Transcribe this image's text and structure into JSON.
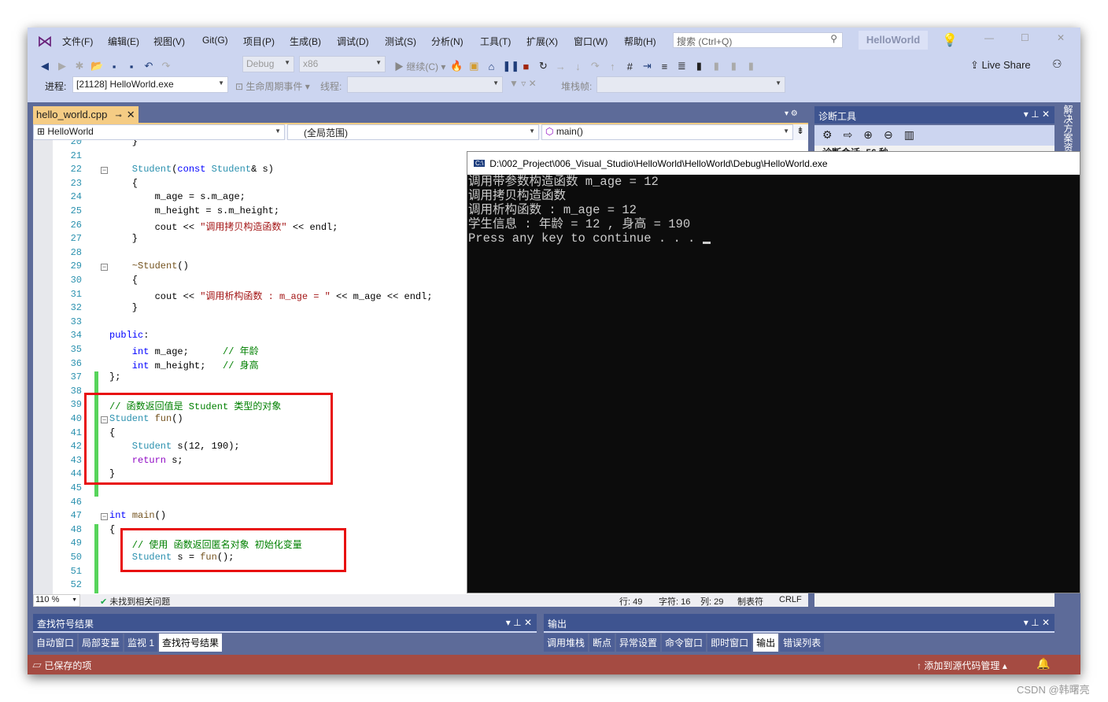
{
  "menu": [
    "文件(F)",
    "编辑(E)",
    "视图(V)",
    "Git(G)",
    "项目(P)",
    "生成(B)",
    "调试(D)",
    "测试(S)",
    "分析(N)",
    "工具(T)",
    "扩展(X)",
    "窗口(W)",
    "帮助(H)"
  ],
  "search": {
    "placeholder": "搜索 (Ctrl+Q)"
  },
  "solution_name": "HelloWorld",
  "toolbar": {
    "config": "Debug",
    "platform": "x86",
    "continue": "继续(C)",
    "live_share": "Live Share"
  },
  "debug_bar": {
    "process_label": "进程:",
    "process_value": "[21128] HelloWorld.exe",
    "lifecycle": "生命周期事件",
    "thread_label": "线程:",
    "stackframe_label": "堆栈帧:"
  },
  "tab": {
    "label": "hello_world.cpp"
  },
  "nav": {
    "project": "HelloWorld",
    "scope": "(全局范围)",
    "member": "main()"
  },
  "code": [
    {
      "n": "20",
      "t": [
        [
          "op",
          "    }"
        ]
      ]
    },
    {
      "n": "21",
      "t": []
    },
    {
      "n": "22",
      "t": [
        [
          "ty",
          "    Student"
        ],
        [
          "op",
          "("
        ],
        [
          "kw",
          "const "
        ],
        [
          "ty",
          "Student"
        ],
        [
          "op",
          "& "
        ],
        [
          "id",
          "s"
        ],
        [
          "op",
          ")"
        ]
      ]
    },
    {
      "n": "23",
      "t": [
        [
          "op",
          "    {"
        ]
      ]
    },
    {
      "n": "24",
      "t": [
        [
          "id",
          "        m_age "
        ],
        [
          "op",
          "= "
        ],
        [
          "id",
          "s.m_age"
        ],
        [
          "op",
          ";"
        ]
      ]
    },
    {
      "n": "25",
      "t": [
        [
          "id",
          "        m_height "
        ],
        [
          "op",
          "= "
        ],
        [
          "id",
          "s.m_height"
        ],
        [
          "op",
          ";"
        ]
      ]
    },
    {
      "n": "26",
      "t": [
        [
          "id",
          "        cout "
        ],
        [
          "op",
          "<< "
        ],
        [
          "st",
          "\"调用拷贝构造函数\""
        ],
        [
          "op",
          " << "
        ],
        [
          "id",
          "endl"
        ],
        [
          "op",
          ";"
        ]
      ]
    },
    {
      "n": "27",
      "t": [
        [
          "op",
          "    }"
        ]
      ]
    },
    {
      "n": "28",
      "t": []
    },
    {
      "n": "29",
      "t": [
        [
          "fn",
          "    ~Student"
        ],
        [
          "op",
          "()"
        ]
      ]
    },
    {
      "n": "30",
      "t": [
        [
          "op",
          "    {"
        ]
      ]
    },
    {
      "n": "31",
      "t": [
        [
          "id",
          "        cout "
        ],
        [
          "op",
          "<< "
        ],
        [
          "st",
          "\"调用析构函数 : m_age = \""
        ],
        [
          "op",
          " << "
        ],
        [
          "id",
          "m_age"
        ],
        [
          "op",
          " << "
        ],
        [
          "id",
          "endl"
        ],
        [
          "op",
          ";"
        ]
      ]
    },
    {
      "n": "32",
      "t": [
        [
          "op",
          "    }"
        ]
      ]
    },
    {
      "n": "33",
      "t": []
    },
    {
      "n": "34",
      "t": [
        [
          "kw",
          "public"
        ],
        [
          "op",
          ":"
        ]
      ]
    },
    {
      "n": "35",
      "t": [
        [
          "kw",
          "    int "
        ],
        [
          "id",
          "m_age"
        ],
        [
          "op",
          ";      "
        ],
        [
          "cm",
          "// 年龄"
        ]
      ]
    },
    {
      "n": "36",
      "t": [
        [
          "kw",
          "    int "
        ],
        [
          "id",
          "m_height"
        ],
        [
          "op",
          ";   "
        ],
        [
          "cm",
          "// 身高"
        ]
      ]
    },
    {
      "n": "37",
      "t": [
        [
          "op",
          "};"
        ]
      ]
    },
    {
      "n": "38",
      "t": []
    },
    {
      "n": "39",
      "t": [
        [
          "cm",
          "// 函数返回值是 Student 类型的对象"
        ]
      ]
    },
    {
      "n": "40",
      "t": [
        [
          "ty",
          "Student "
        ],
        [
          "fn",
          "fun"
        ],
        [
          "op",
          "()"
        ]
      ]
    },
    {
      "n": "41",
      "t": [
        [
          "op",
          "{"
        ]
      ]
    },
    {
      "n": "42",
      "t": [
        [
          "ty",
          "    Student "
        ],
        [
          "id",
          "s"
        ],
        [
          "op",
          "(12, 190);"
        ]
      ]
    },
    {
      "n": "43",
      "t": [
        [
          "pu",
          "    return "
        ],
        [
          "id",
          "s"
        ],
        [
          "op",
          ";"
        ]
      ]
    },
    {
      "n": "44",
      "t": [
        [
          "op",
          "}"
        ]
      ]
    },
    {
      "n": "45",
      "t": []
    },
    {
      "n": "46",
      "t": []
    },
    {
      "n": "47",
      "t": [
        [
          "kw",
          "int "
        ],
        [
          "fn",
          "main"
        ],
        [
          "op",
          "()"
        ]
      ]
    },
    {
      "n": "48",
      "t": [
        [
          "op",
          "{"
        ]
      ]
    },
    {
      "n": "49",
      "t": [
        [
          "cm",
          "    // 使用 函数返回匿名对象 初始化变量"
        ]
      ]
    },
    {
      "n": "50",
      "t": [
        [
          "ty",
          "    Student "
        ],
        [
          "id",
          "s "
        ],
        [
          "op",
          "= "
        ],
        [
          "fn",
          "fun"
        ],
        [
          "op",
          "();"
        ]
      ]
    },
    {
      "n": "51",
      "t": []
    },
    {
      "n": "52",
      "t": []
    }
  ],
  "editor_status": {
    "zoom": "110 %",
    "issues": "未找到相关问题",
    "line": "行: 49",
    "char": "字符: 16",
    "col": "列: 29",
    "tabs": "制表符",
    "eol": "CRLF"
  },
  "diag": {
    "title": "诊断工具",
    "session": "诊断会话: 56 秒"
  },
  "solution_explorer_tab": "解决方案资源管理器",
  "console": {
    "title": "D:\\002_Project\\006_Visual_Studio\\HelloWorld\\HelloWorld\\Debug\\HelloWorld.exe",
    "lines": [
      "调用带参数构造函数 m_age = 12",
      "调用拷贝构造函数",
      "调用析构函数 : m_age = 12",
      "学生信息 : 年龄 = 12 , 身高 = 190",
      "Press any key to continue . . . "
    ]
  },
  "left_panel": {
    "title": "查找符号结果",
    "tabs": [
      "自动窗口",
      "局部变量",
      "监视 1",
      "查找符号结果"
    ],
    "selected": 3
  },
  "right_panel": {
    "title": "输出",
    "tabs": [
      "调用堆栈",
      "断点",
      "异常设置",
      "命令窗口",
      "即时窗口",
      "输出",
      "错误列表"
    ],
    "selected": 5
  },
  "status": {
    "saved": "已保存的项",
    "source_control": "添加到源代码管理"
  },
  "watermark": "CSDN @韩曙亮",
  "colors": {
    "status_bar": "#a54b42",
    "accent": "#5d6b99",
    "tab_active": "#f5cc84",
    "highlight_box": "#e81010"
  }
}
